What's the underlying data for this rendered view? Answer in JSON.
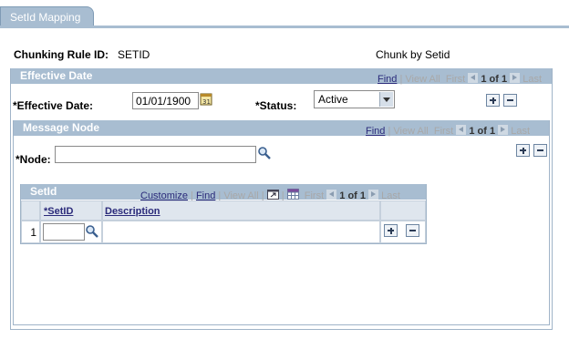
{
  "tab": {
    "label": "SetId Mapping"
  },
  "header": {
    "chunking_rule_label": "Chunking Rule ID:",
    "chunking_rule_value": "SETID",
    "description": "Chunk by Setid"
  },
  "effective_date_section": {
    "title": "Effective Date",
    "nav": {
      "find": "Find",
      "view_all": "View All",
      "first": "First",
      "count": "1 of 1",
      "last": "Last"
    },
    "effective_date_label": "*Effective Date:",
    "effective_date_value": "01/01/1900",
    "status_label": "*Status:",
    "status_value": "Active"
  },
  "message_node_section": {
    "title": "Message Node",
    "nav": {
      "find": "Find",
      "view_all": "View All",
      "first": "First",
      "count": "1 of 1",
      "last": "Last"
    },
    "node_label": "*Node:",
    "node_value": ""
  },
  "setid_grid": {
    "title": "SetId",
    "nav": {
      "customize": "Customize",
      "find": "Find",
      "view_all": "View All",
      "first": "First",
      "count": "1 of 1",
      "last": "Last"
    },
    "columns": [
      "*SetID",
      "Description"
    ],
    "rows": [
      {
        "num": "1",
        "setid": "",
        "description": ""
      }
    ]
  },
  "colors": {
    "header_bg": "#a8bdd1",
    "link": "#2a2a7a"
  },
  "icons": [
    "calendar-icon",
    "lookup-icon",
    "add-row-icon",
    "delete-row-icon",
    "zoom-icon",
    "download-icon",
    "first-arrow-icon",
    "next-arrow-icon"
  ]
}
